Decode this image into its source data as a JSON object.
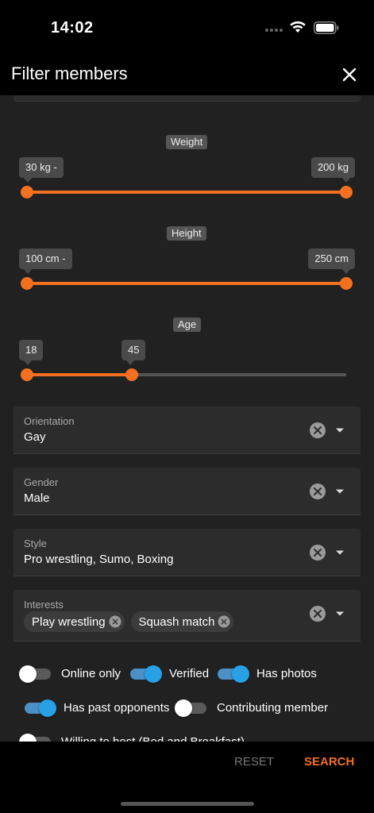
{
  "status_bar": {
    "time": "14:02"
  },
  "header": {
    "title": "Filter members"
  },
  "sliders": {
    "weight": {
      "label": "Weight",
      "min_value": "30 kg -",
      "max_value": "200 kg"
    },
    "height": {
      "label": "Height",
      "min_value": "100 cm -",
      "max_value": "250 cm"
    },
    "age": {
      "label": "Age",
      "min_value": "18",
      "max_value": "45",
      "fill_fraction": 0.33
    }
  },
  "fields": {
    "orientation": {
      "label": "Orientation",
      "value": "Gay"
    },
    "gender": {
      "label": "Gender",
      "value": "Male"
    },
    "style": {
      "label": "Style",
      "value": "Pro wrestling, Sumo, Boxing"
    },
    "interests": {
      "label": "Interests",
      "chips": [
        "Play wrestling",
        "Squash match"
      ]
    }
  },
  "toggles": {
    "online_only": {
      "label": "Online only",
      "on": false
    },
    "verified": {
      "label": "Verified",
      "on": true
    },
    "has_photos": {
      "label": "Has photos",
      "on": true
    },
    "has_past_opponents": {
      "label": "Has past opponents",
      "on": true
    },
    "contributing_member": {
      "label": "Contributing member",
      "on": false
    },
    "willing_to_host": {
      "label": "Willing to host (Bed and Breakfast)",
      "on": false
    }
  },
  "actions": {
    "reset_label": "RESET",
    "search_label": "SEARCH"
  },
  "colors": {
    "accent": "#f37021",
    "toggle_on": "#27a0e6",
    "background": "#212121"
  }
}
